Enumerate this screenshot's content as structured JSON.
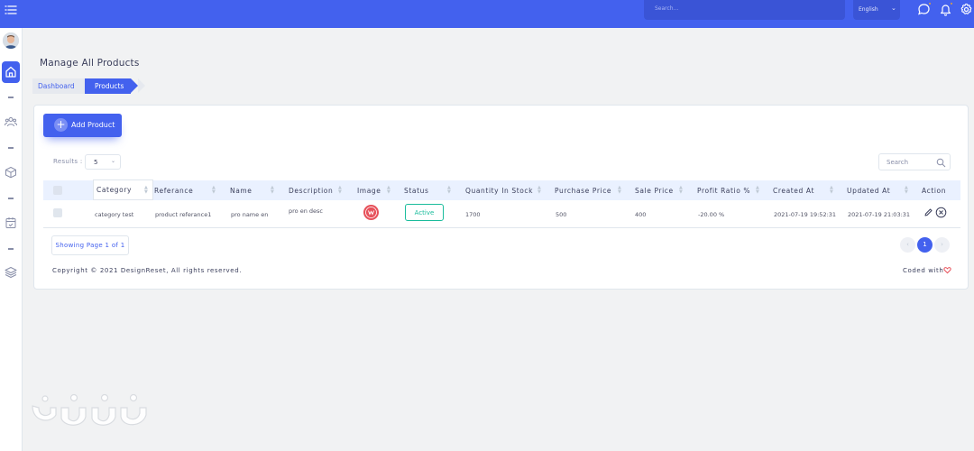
{
  "topbar": {
    "search_placeholder": "Search...",
    "language": "English",
    "accent": "#4361ee"
  },
  "sidebar": {
    "items": [
      "home-icon",
      "users-icon",
      "box-icon",
      "calendar-icon",
      "layers-icon"
    ]
  },
  "page": {
    "title": "Manage All Products"
  },
  "breadcrumb": [
    "Dashboard",
    "Products"
  ],
  "toolbar": {
    "add_label": "Add Product",
    "results_label": "Results :",
    "results_value": "5",
    "search_placeholder": "Search"
  },
  "table": {
    "columns": [
      "Category",
      "Referance",
      "Name",
      "Description",
      "Image",
      "Status",
      "Quantity In Stock",
      "Purchase Price",
      "Sale Price",
      "Profit Ratio %",
      "Created At",
      "Updated At",
      "Action"
    ],
    "rows": [
      {
        "category": "category test",
        "reference": "product referance1",
        "name": "pro name en",
        "description": "pro en desc",
        "status": "Active",
        "quantity": "1700",
        "purchase_price": "500",
        "sale_price": "400",
        "profit_ratio": "-20.00 %",
        "created_at": "2021-07-19 19:52:31",
        "updated_at": "2021-07-19 21:03:31"
      }
    ]
  },
  "pagination": {
    "showing": "Showing Page 1 of 1",
    "current": "1"
  },
  "footer": {
    "copyright": "Copyright © 2021 DesignReset, All rights reserved.",
    "coded_with": "Coded with"
  }
}
